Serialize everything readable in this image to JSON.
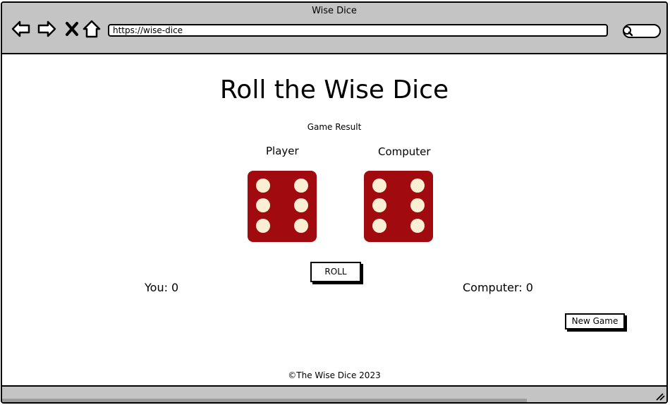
{
  "window": {
    "title": "Wise Dice"
  },
  "address_bar": {
    "url": "https://wise-dice"
  },
  "toolbar": {
    "icons": [
      "back-arrow-icon",
      "forward-arrow-icon",
      "close-x-icon",
      "home-icon",
      "search-icon"
    ]
  },
  "page": {
    "title": "Roll the Wise Dice",
    "result_text": "Game Result",
    "player_label": "Player",
    "computer_label": "Computer",
    "player_die": {
      "value": 6,
      "color": "#a10a0f",
      "pip_color": "#fbefd3"
    },
    "computer_die": {
      "value": 6,
      "color": "#a10a0f",
      "pip_color": "#fbefd3"
    },
    "roll_button": "ROLL",
    "player_score": "You: 0",
    "computer_score": "Computer: 0",
    "new_game_button": "New Game",
    "footer": "©The Wise Dice 2023"
  }
}
